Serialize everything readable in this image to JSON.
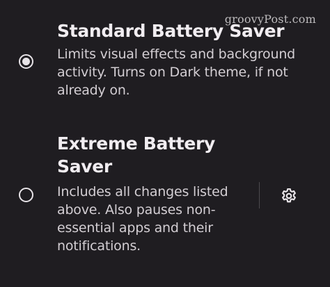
{
  "watermark": "groovyPost.com",
  "options": [
    {
      "title": "Standard Battery Saver",
      "description": "Limits visual effects and background activity. Turns on Dark theme, if not already on.",
      "selected": true
    },
    {
      "title": "Extreme Battery Saver",
      "description": "Includes all changes listed above. Also pauses non-essential apps and their notifications.",
      "selected": false,
      "settings_icon": "gear-icon"
    }
  ],
  "colors": {
    "background": "#1f1d21",
    "text": "#f1edf1",
    "secondary_text": "#d3ced3"
  }
}
